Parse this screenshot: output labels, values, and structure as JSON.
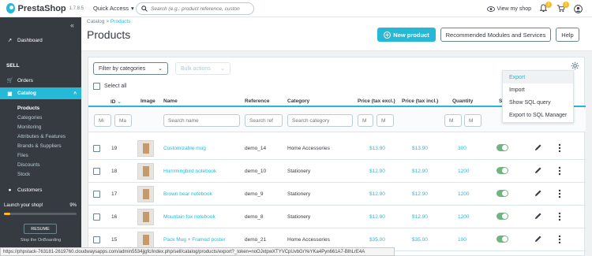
{
  "brand": {
    "name": "PrestaShop",
    "version": "1.7.8.5"
  },
  "header": {
    "quick_access": "Quick Access",
    "search_placeholder": "Search (e.g.: product reference, custon",
    "view_shop": "View my shop",
    "orders_badge": "2",
    "customers_badge": "1"
  },
  "sidebar": {
    "dashboard": "Dashboard",
    "sell_title": "SELL",
    "orders": "Orders",
    "catalog": "Catalog",
    "sub": [
      "Products",
      "Categories",
      "Monitoring",
      "Attributes & Features",
      "Brands & Suppliers",
      "Files",
      "Discounts",
      "Stock"
    ],
    "customers": "Customers",
    "onboarding_text": "Launch your shop!",
    "onboarding_percent": "9%",
    "onboarding_progress": 0.09,
    "resume": "RESUME",
    "stop": "Stop the OnBoarding"
  },
  "page": {
    "breadcrumb_root": "Catalog",
    "breadcrumb_sep": ">",
    "breadcrumb_current": "Products",
    "title": "Products",
    "new_product": "New product",
    "recommended": "Recommended Modules and Services",
    "help": "Help"
  },
  "toolbar": {
    "filter_categories": "Filter by categories",
    "bulk_actions": "Bulk actions",
    "select_all": "Select all"
  },
  "table": {
    "headers": [
      "ID",
      "Image",
      "Name",
      "Reference",
      "Category",
      "Price (tax excl.)",
      "Price (tax incl.)",
      "Quantity",
      "St"
    ],
    "filters": {
      "id_min": "Mi",
      "id_max": "Ma",
      "name": "Search name",
      "ref": "Search ref",
      "category": "Search category",
      "price_min": "M",
      "price_max": "M",
      "qty_min": "M",
      "qty_max": "M"
    },
    "rows": [
      {
        "id": "19",
        "name": "Customizable mug",
        "ref": "demo_14",
        "category": "Home Accessories",
        "price_excl": "$13.90",
        "price_incl": "$13.90",
        "qty": "300"
      },
      {
        "id": "18",
        "name": "Hummingbird notebook",
        "ref": "demo_10",
        "category": "Stationery",
        "price_excl": "$12.90",
        "price_incl": "$12.90",
        "qty": "1200"
      },
      {
        "id": "17",
        "name": "Brown bear notebook",
        "ref": "demo_9",
        "category": "Stationery",
        "price_excl": "$12.90",
        "price_incl": "$12.90",
        "qty": "1200"
      },
      {
        "id": "16",
        "name": "Mountain fox notebook",
        "ref": "demo_8",
        "category": "Stationery",
        "price_excl": "$12.90",
        "price_incl": "$12.90",
        "qty": "1200"
      },
      {
        "id": "15",
        "name": "Pack Mug + Framed poster",
        "ref": "demo_21",
        "category": "Home Accessories",
        "price_excl": "$35.00",
        "price_incl": "$35.00",
        "qty": "100"
      }
    ]
  },
  "dropdown": {
    "items": [
      "Export",
      "Import",
      "Show SQL query",
      "Export to SQL Manager"
    ]
  },
  "statusbar": "https://phpstack-763181-2619760.cloudwaysapps.com/admin5534jjgfc/index.php/sell/catalog/products/export?_token=noOJxtpwXTYVCpUvbGrYeYKa4Pyn661A7-BlhLrE4A",
  "colors": {
    "accent": "#25b9d7",
    "sidebar": "#363a41",
    "active_toggle": "#70b580",
    "badge": "#fbbb22"
  }
}
